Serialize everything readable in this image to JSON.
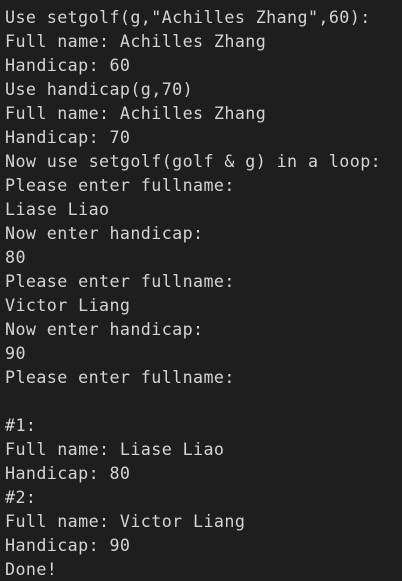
{
  "terminal": {
    "lines": [
      "Use setgolf(g,\"Achilles Zhang\",60):",
      "Full name: Achilles Zhang",
      "Handicap: 60",
      "Use handicap(g,70)",
      "Full name: Achilles Zhang",
      "Handicap: 70",
      "Now use setgolf(golf & g) in a loop:",
      "Please enter fullname:",
      "Liase Liao",
      "Now enter handicap:",
      "80",
      "Please enter fullname:",
      "Victor Liang",
      "Now enter handicap:",
      "90",
      "Please enter fullname:",
      "",
      "#1:",
      "Full name: Liase Liao",
      "Handicap: 80",
      "#2:",
      "Full name: Victor Liang",
      "Handicap: 90",
      "Done!"
    ],
    "colors": {
      "background": "#1e1e1e",
      "text": "#d4d4d4"
    }
  }
}
